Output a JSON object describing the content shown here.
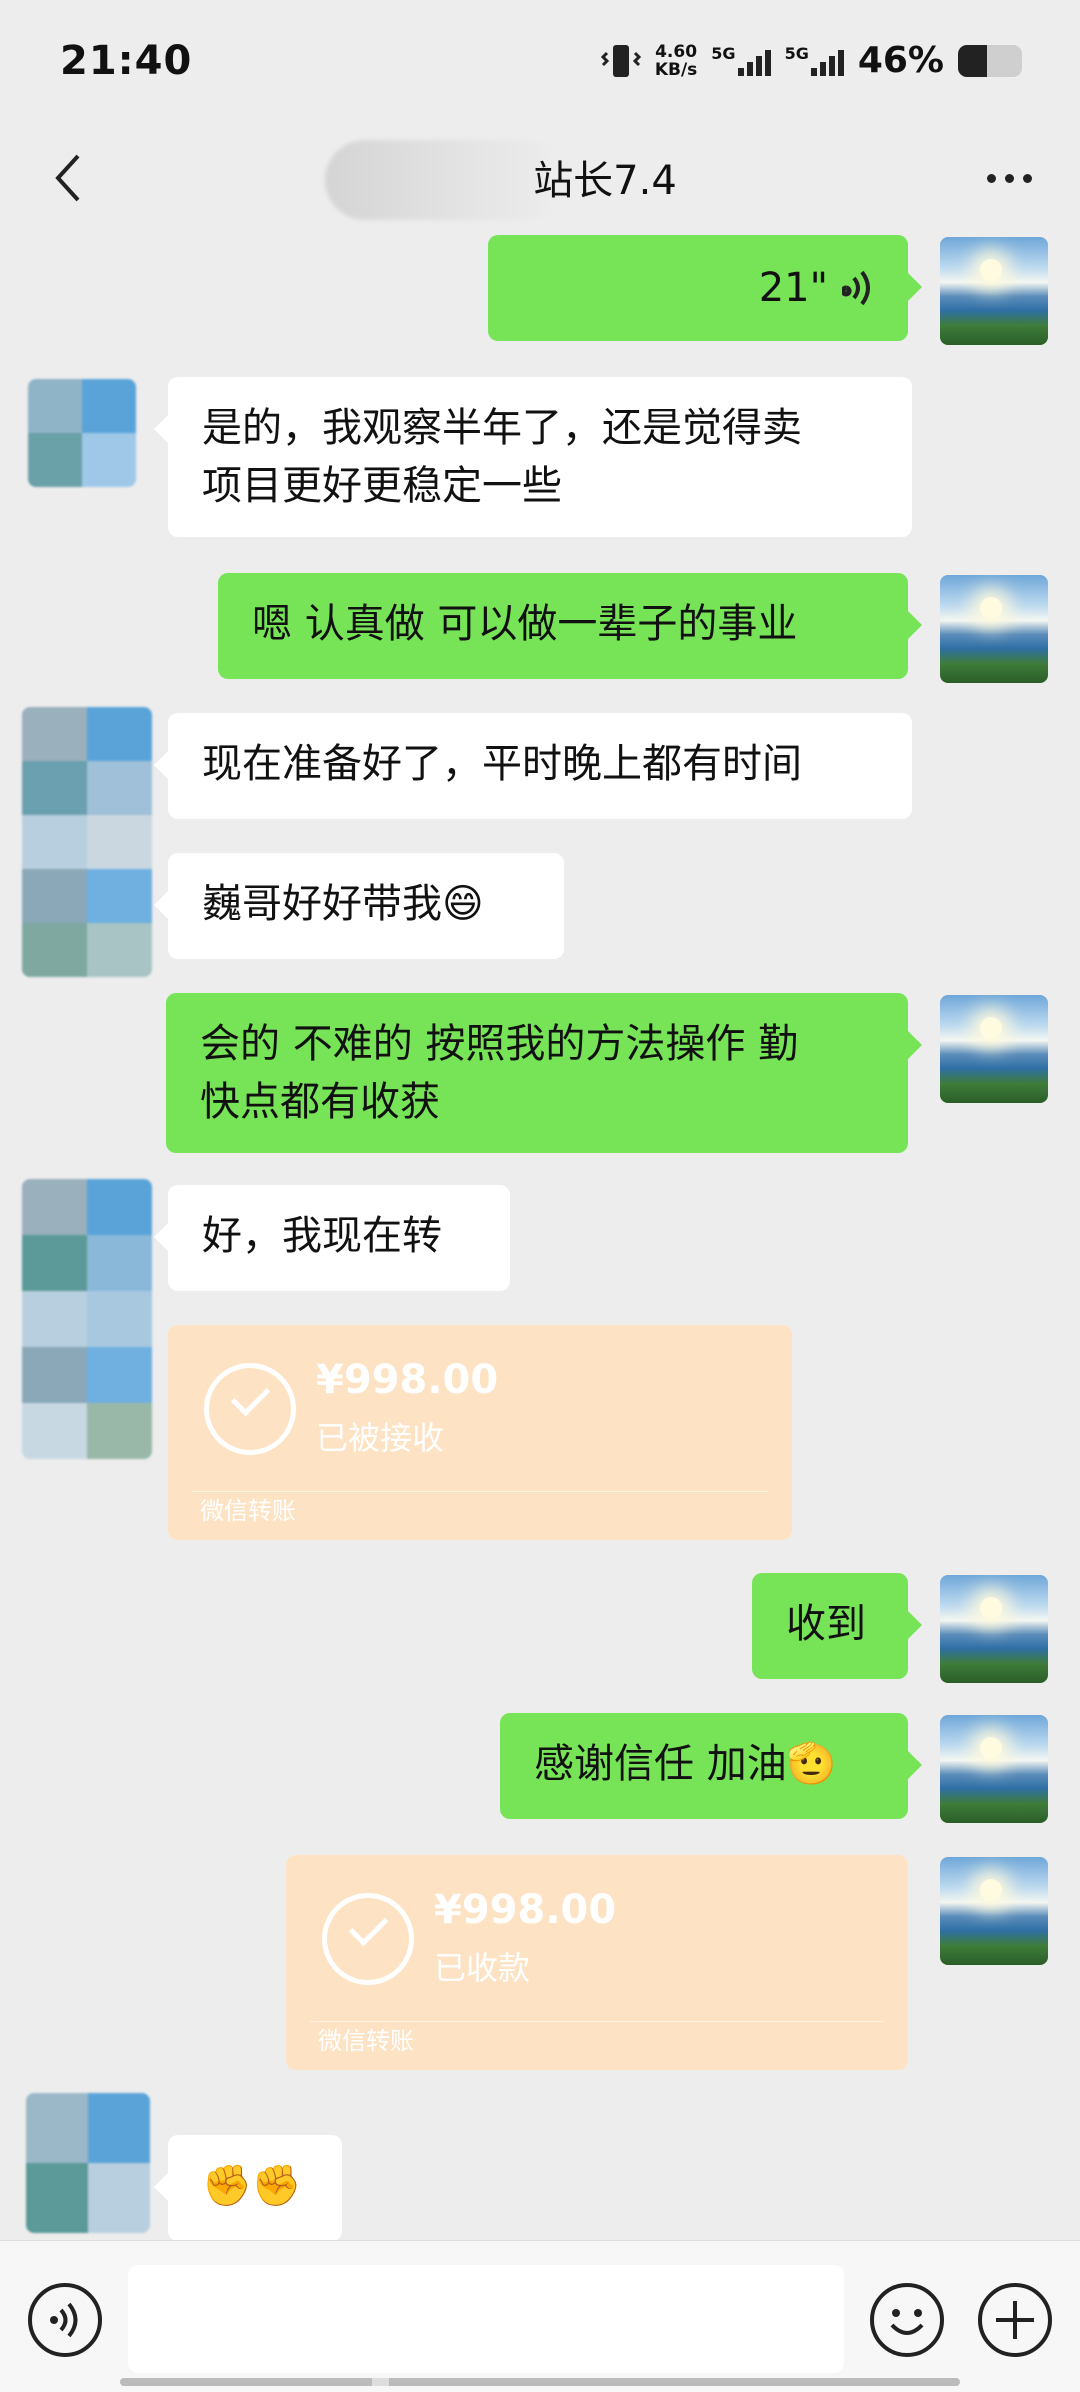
{
  "status_bar": {
    "time": "21:40",
    "net_speed_value": "4.60",
    "net_speed_unit": "KB/s",
    "sim1": "5G",
    "sim2": "5G",
    "battery_percent": "46%",
    "battery_level": 0.46
  },
  "header": {
    "title": "站长7.4",
    "back_icon": "chevron-left-icon",
    "more_icon": "more-dots-icon"
  },
  "messages": [
    {
      "side": "out",
      "type": "voice",
      "duration": "21\""
    },
    {
      "side": "in",
      "type": "text",
      "line1": "是的，我观察半年了，还是觉得卖",
      "line2": "项目更好更稳定一些"
    },
    {
      "side": "out",
      "type": "text",
      "text": "嗯 认真做 可以做一辈子的事业"
    },
    {
      "side": "in",
      "type": "text",
      "text": "现在准备好了，平时晚上都有时间"
    },
    {
      "side": "in",
      "type": "text",
      "text": "巍哥好好带我😄"
    },
    {
      "side": "out",
      "type": "text",
      "line1": "会的 不难的 按照我的方法操作 勤",
      "line2": "快点都有收获"
    },
    {
      "side": "in",
      "type": "text",
      "text": "好，我现在转"
    },
    {
      "side": "in",
      "type": "transfer",
      "amount": "¥998.00",
      "status": "已被接收",
      "label": "微信转账"
    },
    {
      "side": "out",
      "type": "text",
      "text": "收到"
    },
    {
      "side": "out",
      "type": "text",
      "text": "感谢信任 加油🫡"
    },
    {
      "side": "out",
      "type": "transfer",
      "amount": "¥998.00",
      "status": "已收款",
      "label": "微信转账"
    },
    {
      "side": "in",
      "type": "text",
      "text": "✊✊"
    }
  ],
  "input_bar": {
    "voice_icon": "voice-input-icon",
    "emoji_icon": "emoji-icon",
    "plus_icon": "plus-icon",
    "placeholder": ""
  },
  "colors": {
    "background": "#ededed",
    "outgoing_bubble": "#95ec69",
    "incoming_bubble": "#ffffff",
    "transfer_card": "#fde3c4"
  }
}
